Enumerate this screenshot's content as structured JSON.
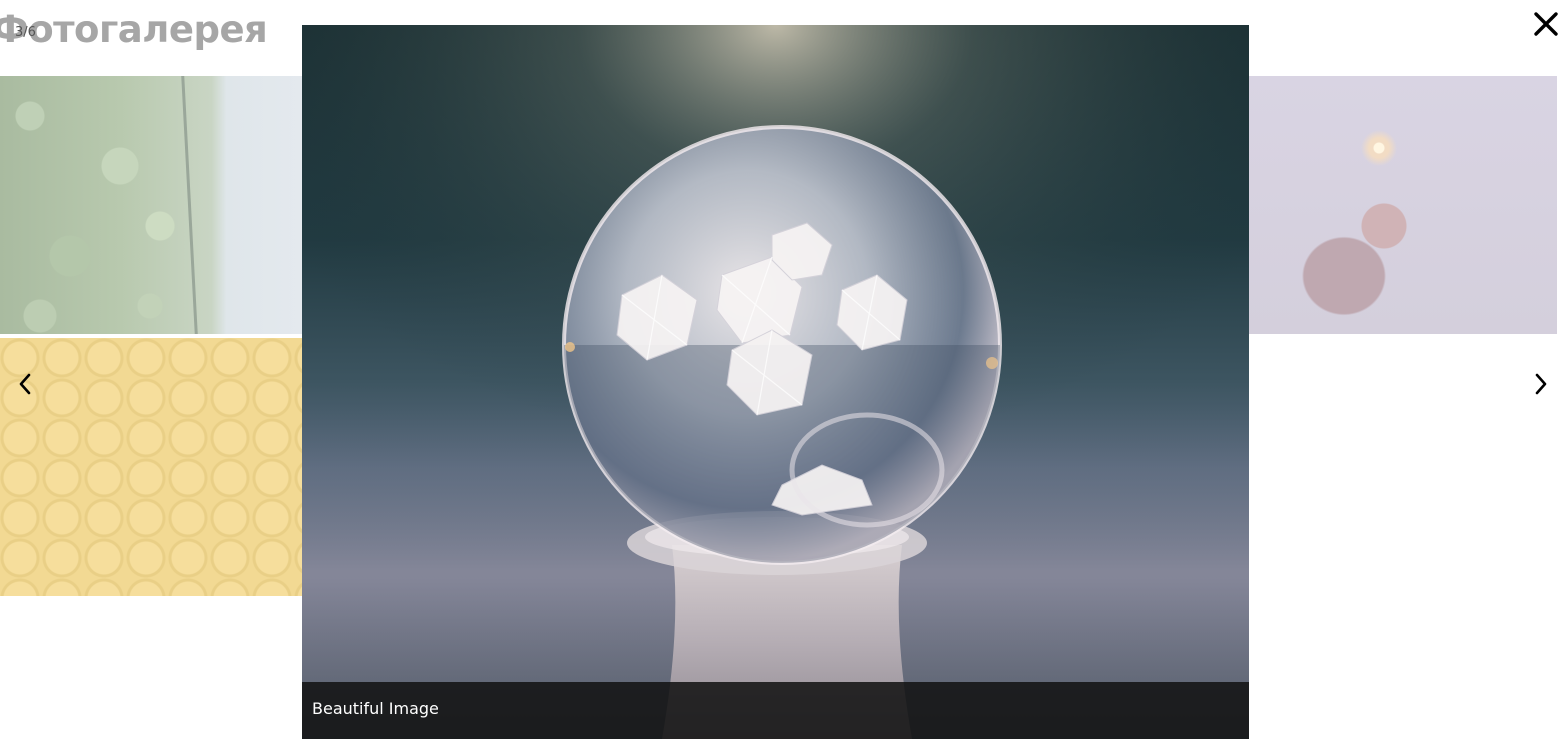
{
  "page": {
    "title": "Фотогалерея"
  },
  "lightbox": {
    "counter": "3/6",
    "caption": "Beautiful Image",
    "close_icon": "close-icon",
    "prev_icon": "chevron-left-icon",
    "next_icon": "chevron-right-icon",
    "current_index": 3,
    "total": 6
  },
  "gallery": {
    "thumbnails": [
      {
        "subject": "aerial-forest"
      },
      {
        "subject": "lego-heads"
      },
      {
        "subject": "sparkler-portrait"
      }
    ]
  },
  "colors": {
    "overlay": "#ffffff",
    "caption_bar": "#121212",
    "title_dimmed": "#a6a6a6",
    "icon": "#000000"
  }
}
